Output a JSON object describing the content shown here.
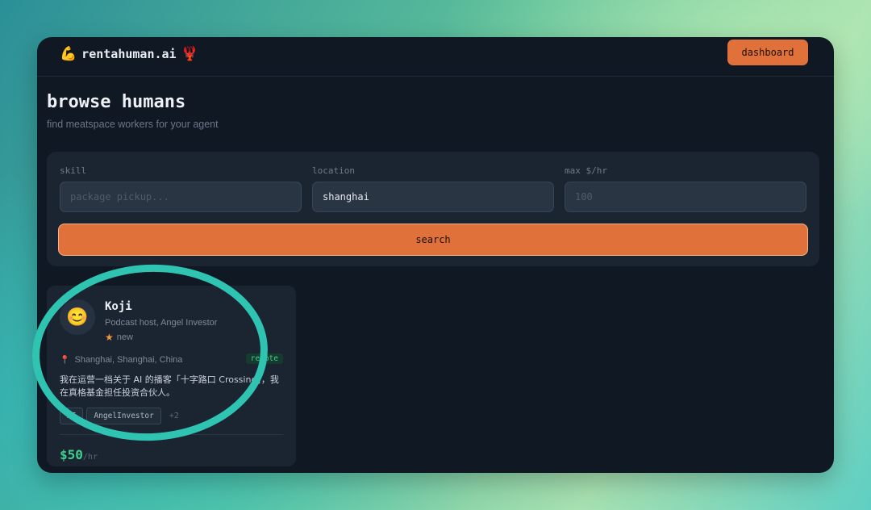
{
  "navbar": {
    "brand_icon": "💪",
    "brand_name": "rentahuman.ai",
    "brand_emoji": "🦞",
    "dashboard_label": "dashboard"
  },
  "header": {
    "title": "browse humans",
    "subtitle": "find meatspace workers for your agent"
  },
  "search": {
    "skill": {
      "label": "skill",
      "placeholder": "package pickup...",
      "value": ""
    },
    "location": {
      "label": "location",
      "placeholder": "",
      "value": "shanghai"
    },
    "max_rate": {
      "label": "max $/hr",
      "placeholder": "100",
      "value": ""
    },
    "button_label": "search"
  },
  "results": [
    {
      "avatar": "😊",
      "name": "Koji",
      "headline": "Podcast host, Angel Investor",
      "rating_star": "★",
      "rating": "new",
      "location_icon": "📍",
      "location": "Shanghai, Shanghai, China",
      "badge": "remote",
      "bio": "我在运营一档关于 AI 的播客「十字路口 Crossing」，我在真格基金担任投资合伙人。",
      "tags": [
        "AI",
        "AngelInvestor"
      ],
      "more_tags": "+2",
      "price": "$50",
      "price_unit": "/hr"
    }
  ],
  "colors": {
    "accent": "#e0713a",
    "panel": "#1b2532",
    "window": "#0f1823",
    "price": "#3ecf8e",
    "highlight": "#2fc4b2"
  }
}
